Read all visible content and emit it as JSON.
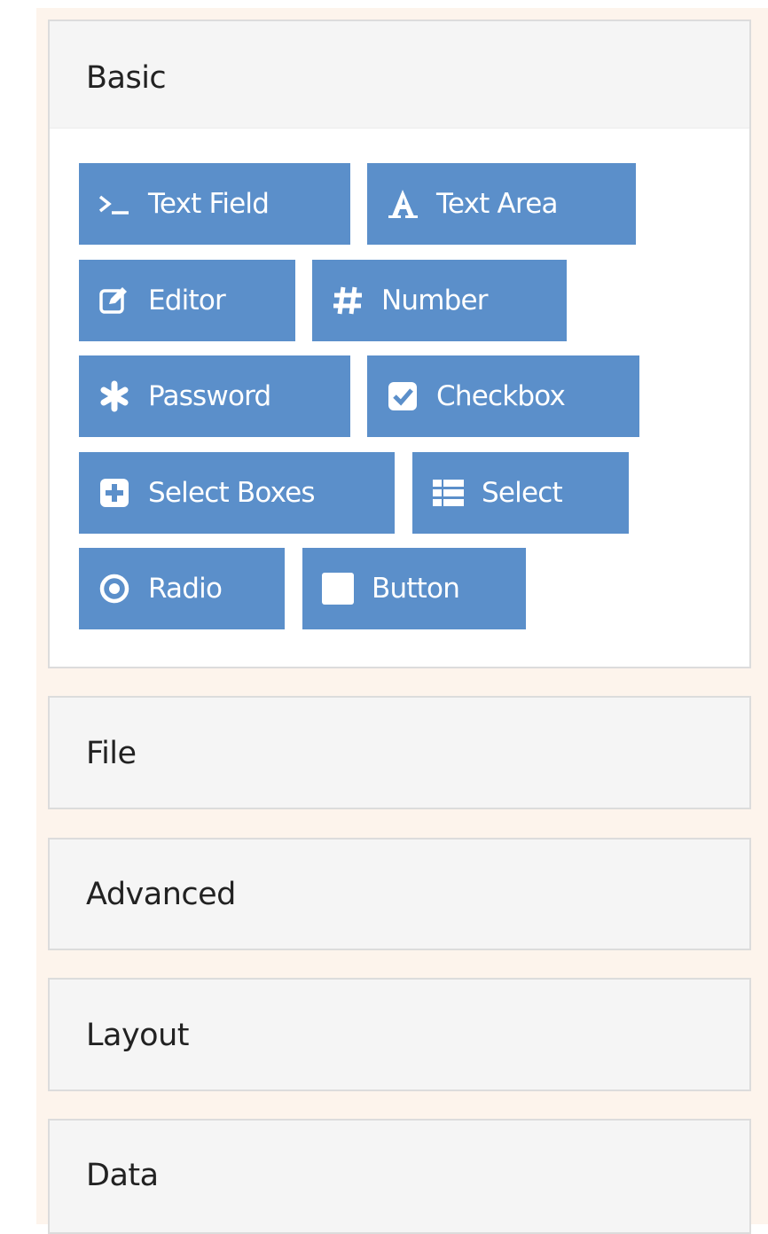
{
  "colors": {
    "sidebar_bg": "#fdf4ec",
    "button_bg": "#5b8fca",
    "panel_header_bg": "#f5f5f5",
    "panel_border": "#dcdcdc"
  },
  "panels": {
    "basic": {
      "title": "Basic",
      "expanded": true,
      "components": [
        {
          "label": "Text Field",
          "icon": "terminal-icon"
        },
        {
          "label": "Text Area",
          "icon": "font-icon"
        },
        {
          "label": "Editor",
          "icon": "edit-icon"
        },
        {
          "label": "Number",
          "icon": "hashtag-icon"
        },
        {
          "label": "Password",
          "icon": "asterisk-icon"
        },
        {
          "label": "Checkbox",
          "icon": "check-square-icon"
        },
        {
          "label": "Select Boxes",
          "icon": "plus-square-icon"
        },
        {
          "label": "Select",
          "icon": "list-icon"
        },
        {
          "label": "Radio",
          "icon": "dot-circle-icon"
        },
        {
          "label": "Button",
          "icon": "stop-icon"
        }
      ]
    },
    "file": {
      "title": "File",
      "expanded": false
    },
    "advanced": {
      "title": "Advanced",
      "expanded": false
    },
    "layout": {
      "title": "Layout",
      "expanded": false
    },
    "data": {
      "title": "Data",
      "expanded": false
    }
  }
}
